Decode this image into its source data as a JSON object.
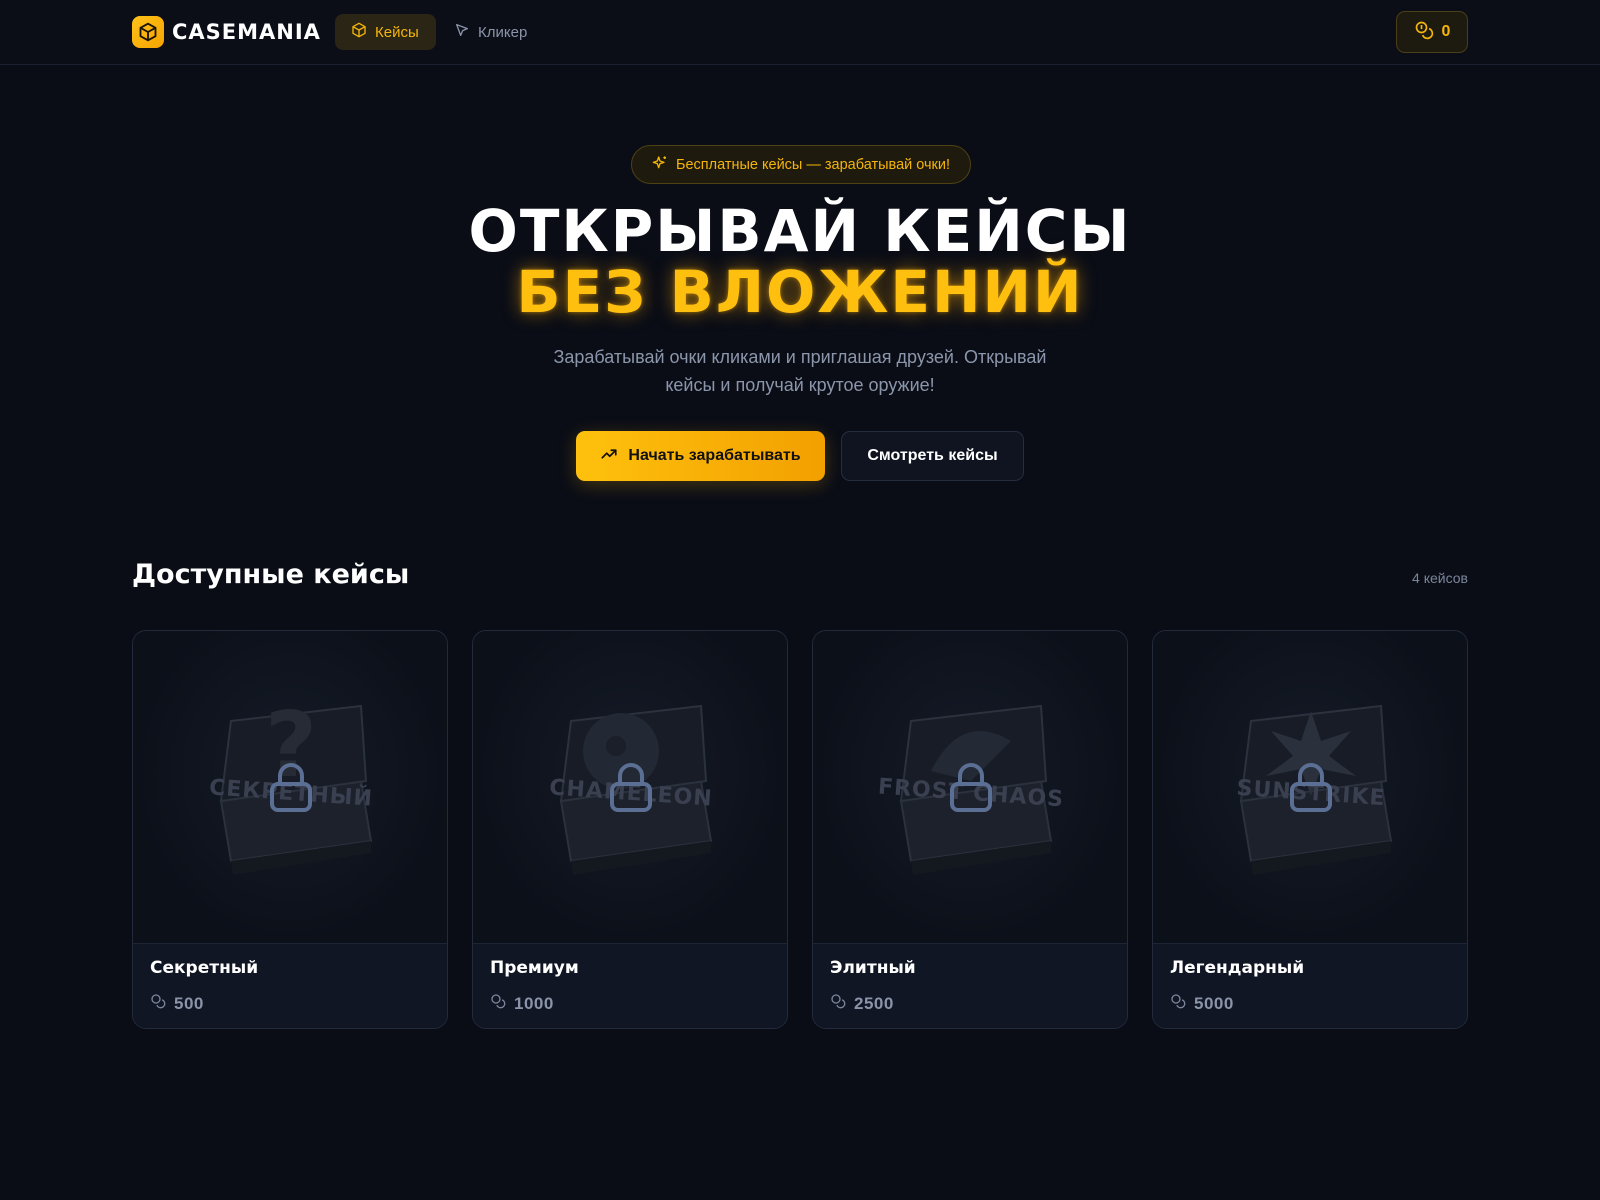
{
  "header": {
    "logo_text": "CASEMANIA",
    "nav": [
      {
        "label": "Кейсы",
        "active": true
      },
      {
        "label": "Кликер",
        "active": false
      }
    ],
    "balance": "0"
  },
  "hero": {
    "badge": "Бесплатные кейсы — зарабатывай очки!",
    "title_line1": "ОТКРЫВАЙ КЕЙСЫ",
    "title_line2": "БЕЗ ВЛОЖЕНИЙ",
    "subtitle": "Зарабатывай очки кликами и приглашая друзей. Открывай кейсы и получай крутое оружие!",
    "primary_button": "Начать зарабатывать",
    "secondary_button": "Смотреть кейсы"
  },
  "cases_section": {
    "title": "Доступные кейсы",
    "count": "4 кейсов",
    "cases": [
      {
        "name": "Секретный",
        "price": "500",
        "art_label": "СЕКРЕТНЫЙ",
        "locked": true
      },
      {
        "name": "Премиум",
        "price": "1000",
        "art_label": "CHAMELEON",
        "locked": true
      },
      {
        "name": "Элитный",
        "price": "2500",
        "art_label": "FROST CHAOS",
        "locked": true
      },
      {
        "name": "Легендарный",
        "price": "5000",
        "art_label": "SUNSTRIKE",
        "locked": true
      }
    ]
  },
  "colors": {
    "accent": "#f5b50a",
    "background": "#0a0d16",
    "card": "#0c1019"
  }
}
